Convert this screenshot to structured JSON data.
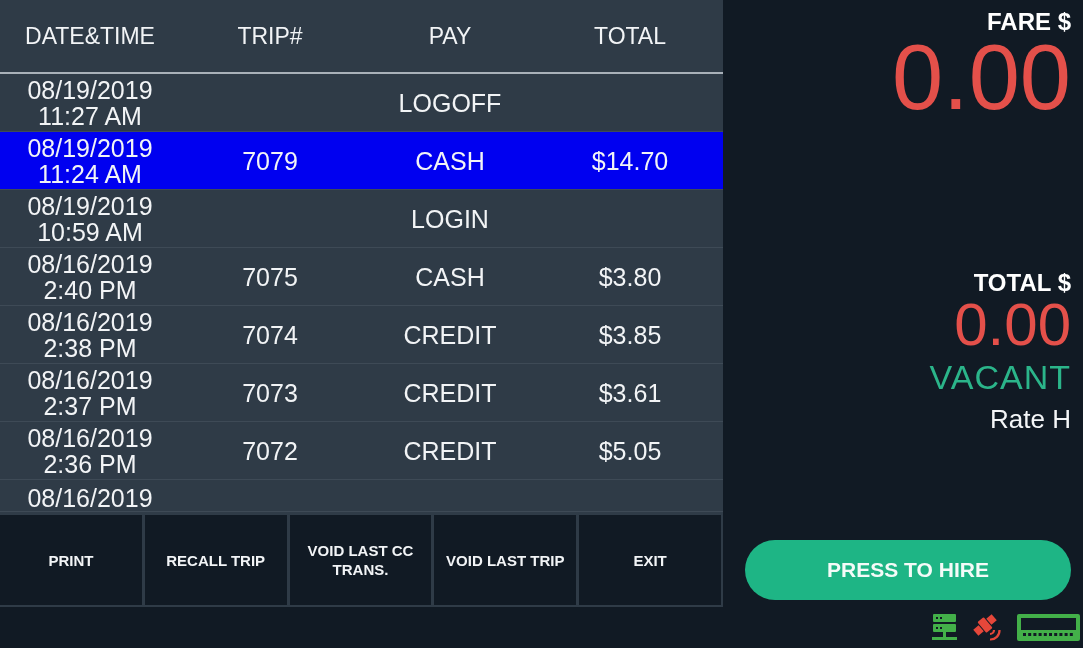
{
  "table": {
    "columns": [
      "DATE&TIME",
      "TRIP#",
      "PAY",
      "TOTAL"
    ],
    "rows": [
      {
        "date": "08/19/2019",
        "time": "11:27 AM",
        "pay": "LOGOFF",
        "selected": false
      },
      {
        "date": "08/19/2019",
        "time": "11:24 AM",
        "trip": "7079",
        "pay": "CASH",
        "total": "$14.70",
        "selected": true
      },
      {
        "date": "08/19/2019",
        "time": "10:59 AM",
        "pay": "LOGIN",
        "selected": false
      },
      {
        "date": "08/16/2019",
        "time": "2:40 PM",
        "trip": "7075",
        "pay": "CASH",
        "total": "$3.80",
        "selected": false
      },
      {
        "date": "08/16/2019",
        "time": "2:38 PM",
        "trip": "7074",
        "pay": "CREDIT",
        "total": "$3.85",
        "selected": false
      },
      {
        "date": "08/16/2019",
        "time": "2:37 PM",
        "trip": "7073",
        "pay": "CREDIT",
        "total": "$3.61",
        "selected": false
      },
      {
        "date": "08/16/2019",
        "time": "2:36 PM",
        "trip": "7072",
        "pay": "CREDIT",
        "total": "$5.05",
        "selected": false
      },
      {
        "date": "08/16/2019",
        "selected": false
      }
    ]
  },
  "toolbar": {
    "buttons": [
      "PRINT",
      "RECALL TRIP",
      "VOID LAST CC TRANS.",
      "VOID LAST TRIP",
      "EXIT"
    ]
  },
  "meter": {
    "fare_label": "FARE $",
    "fare": "0.00",
    "total_label": "TOTAL $",
    "total": "0.00",
    "status": "VACANT",
    "rate": "Rate H"
  },
  "hire_button": "PRESS TO HIRE",
  "status_icons": [
    {
      "kind": "network",
      "color": "#43b049"
    },
    {
      "kind": "gps",
      "color": "#e5473a"
    },
    {
      "kind": "meter",
      "color": "#43b049"
    }
  ]
}
